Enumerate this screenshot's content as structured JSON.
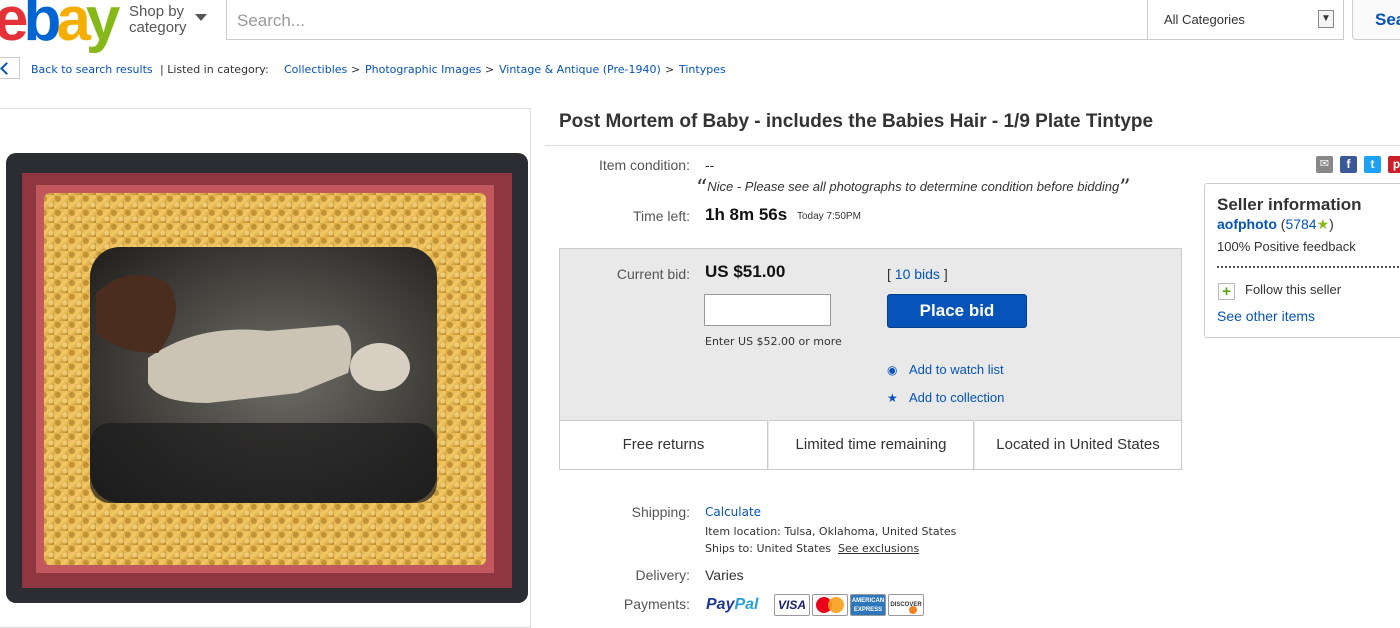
{
  "header": {
    "logo": {
      "e": "e",
      "b": "b",
      "a": "a",
      "y": "y"
    },
    "shop_by_line1": "Shop by",
    "shop_by_line2": "category",
    "search_placeholder": "Search...",
    "category_select": "All Categories",
    "search_button": "Sea"
  },
  "breadcrumb": {
    "back": "Back to search results",
    "listed_in": "| Listed in category:",
    "separator": ">",
    "items": [
      "Collectibles",
      "Photographic Images",
      "Vintage & Antique (Pre-1940)",
      "Tintypes"
    ]
  },
  "item": {
    "title": "Post Mortem of Baby - includes the Babies Hair - 1/9 Plate Tintype",
    "condition_label": "Item condition:",
    "condition_value": "--",
    "condition_note": "Nice - Please see all photographs to determine condition before bidding",
    "quote_open": "“",
    "quote_close": "”",
    "time_left_label": "Time left:",
    "time_left": "1h 8m 56s",
    "end_time": "Today 7:50PM"
  },
  "bid": {
    "current_label": "Current bid:",
    "current_value": "US $51.00",
    "bids_open": "[ ",
    "bids_count": "10 bids",
    "bids_close": " ]",
    "input_value": "",
    "enter_hint": "Enter US $52.00 or more",
    "place_bid": "Place bid",
    "watch": "Add to watch list",
    "collection": "Add to collection",
    "features": [
      "Free returns",
      "Limited time remaining",
      "Located in United States"
    ]
  },
  "shipping": {
    "label": "Shipping:",
    "calculate": "Calculate",
    "location_label": "Item location:",
    "location": "Tulsa, Oklahoma, United States",
    "ships_to_label": "Ships to:",
    "ships_to": "United States",
    "exclusions": "See exclusions",
    "delivery_label": "Delivery:",
    "delivery": "Varies",
    "payments_label": "Payments:",
    "paypal_1": "Pay",
    "paypal_2": "Pal",
    "visa": "VISA",
    "amex_1": "AMERICAN",
    "amex_2": "EXPRESS",
    "discover": "DISCOVER"
  },
  "seller": {
    "heading": "Seller information",
    "name": "aofphoto",
    "score_open": " (",
    "score": "5784",
    "score_close": ")",
    "feedback": "100% Positive feedback",
    "follow": "Follow this seller",
    "other_items": "See other items"
  },
  "colors": {
    "link": "#0654ba",
    "place_bid_bg": "#0654ba",
    "bid_box_bg": "#e9e9e9",
    "ebay_red": "#e53238",
    "ebay_blue": "#0064d2",
    "ebay_yellow": "#f5af02",
    "ebay_green": "#86b817"
  },
  "icons": {
    "share": [
      "mail-icon",
      "facebook-icon",
      "twitter-icon",
      "pinterest-icon"
    ],
    "watch": "eye-icon",
    "collection": "star-icon",
    "back": "chevron-left-icon",
    "follow": "plus-icon"
  }
}
